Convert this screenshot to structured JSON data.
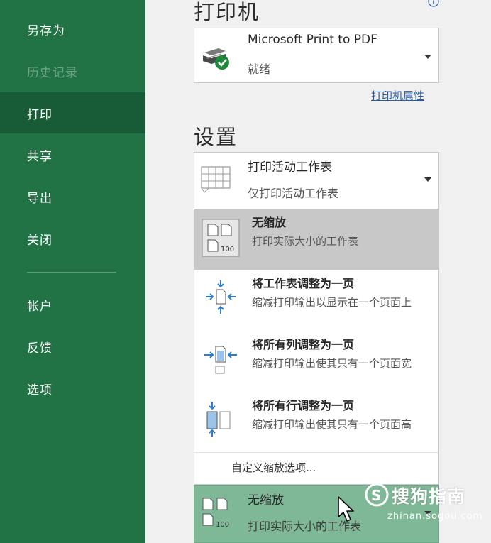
{
  "sidebar": {
    "items": [
      {
        "label": "另存为",
        "state": "normal"
      },
      {
        "label": "历史记录",
        "state": "disabled"
      },
      {
        "label": "打印",
        "state": "active"
      },
      {
        "label": "共享",
        "state": "normal"
      },
      {
        "label": "导出",
        "state": "normal"
      },
      {
        "label": "关闭",
        "state": "normal"
      },
      {
        "label": "帐户",
        "state": "normal"
      },
      {
        "label": "反馈",
        "state": "normal"
      },
      {
        "label": "选项",
        "state": "normal"
      }
    ]
  },
  "printer": {
    "section_title": "打印机",
    "name": "Microsoft Print to PDF",
    "status": "就绪",
    "properties_link": "打印机属性"
  },
  "settings": {
    "section_title": "设置",
    "print_what": {
      "title": "打印活动工作表",
      "sub": "仅打印活动工作表"
    },
    "scaling_options": [
      {
        "title": "无缩放",
        "desc": "打印实际大小的工作表",
        "icon": "no-scaling-icon",
        "selected": true
      },
      {
        "title": "将工作表调整为一页",
        "desc": "缩减打印输出以显示在一个页面上",
        "icon": "fit-sheet-icon",
        "selected": false
      },
      {
        "title": "将所有列调整为一页",
        "desc": "缩减打印输出使其只有一个页面宽",
        "icon": "fit-columns-icon",
        "selected": false
      },
      {
        "title": "将所有行调整为一页",
        "desc": "缩减打印输出使其只有一个页面高",
        "icon": "fit-rows-icon",
        "selected": false
      }
    ],
    "custom_scaling": "自定义缩放选项...",
    "current_scaling": {
      "title": "无缩放",
      "sub": "打印实际大小的工作表"
    }
  },
  "watermark": {
    "brand": "搜狗指南",
    "url": "zhinan.sogou.com"
  },
  "colors": {
    "sidebar_bg": "#217346",
    "active_bg": "#185c37",
    "highlight": "#7fb896"
  }
}
